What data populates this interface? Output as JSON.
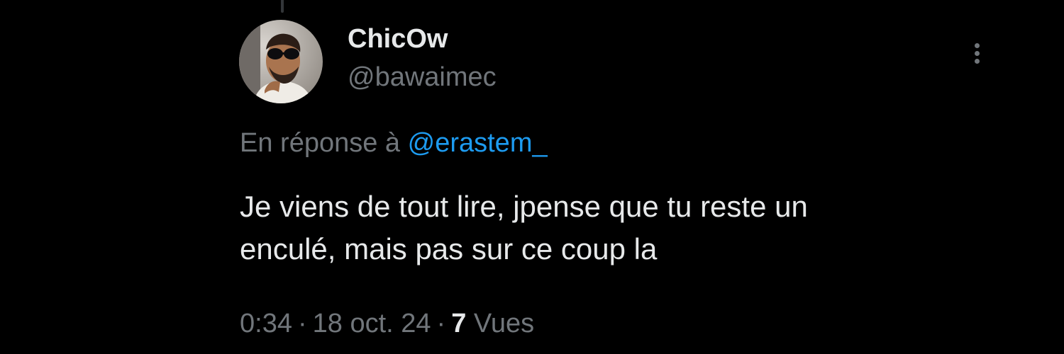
{
  "author": {
    "display_name": "ChicOw",
    "handle": "@bawaimec"
  },
  "reply": {
    "prefix": "En réponse à",
    "mention": "@erastem_"
  },
  "tweet": {
    "line1": "Je viens de tout lire, jpense que tu reste un",
    "line2": "enculé, mais pas sur ce coup la"
  },
  "meta": {
    "time": "0:34",
    "separator": "·",
    "date": "18 oct. 24",
    "views_count": "7",
    "views_label": "Vues"
  },
  "icons": {
    "more": "more-vertical-icon"
  },
  "colors": {
    "background": "#000000",
    "primary_text": "#e7e9ea",
    "secondary_text": "#71767b",
    "link": "#1d9bf0"
  }
}
